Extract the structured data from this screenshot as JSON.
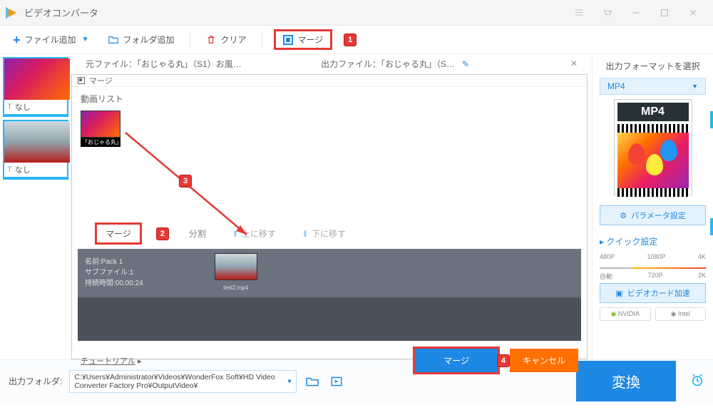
{
  "app": {
    "title": "ビデオコンバータ"
  },
  "toolbar": {
    "add_file": "ファイル追加",
    "add_folder": "フォルダ追加",
    "clear": "クリア",
    "merge": "マージ"
  },
  "badges": {
    "b1": "1",
    "b2": "2",
    "b3": "3",
    "b4": "4"
  },
  "left_thumbs": {
    "items": [
      {
        "label": "なし"
      },
      {
        "label": "なし"
      }
    ]
  },
  "file_header": {
    "source_label": "元ファイル：",
    "source_value": "「おじゃる丸」（S1）お風…",
    "output_label": "出力ファイル：",
    "output_value": "「おじゃる丸」（S…"
  },
  "merge_dialog": {
    "title": "マージ",
    "video_list_label": "動画リスト",
    "thumb_name": "「おじゃる丸」",
    "mid_buttons": {
      "merge": "マージ",
      "split": "分割",
      "move_up": "上に移す",
      "move_down": "下に移す"
    },
    "pack": {
      "name_label": "名前:Pack 1",
      "subfile_label": "サブファイル:1",
      "duration_label": "持続時間:00:00:24",
      "thumb_name": "test2.mp4"
    },
    "tutorial": "チュートリアル",
    "merge_btn": "マージ",
    "cancel_btn": "キャンセル"
  },
  "right_panel": {
    "format_title": "出力フォーマットを選択",
    "format_name": "MP4",
    "format_badge": "MP4",
    "param_btn": "パラメータ設定",
    "quick_title": "クイック設定",
    "quality": {
      "q1": "480P",
      "q2": "1080P",
      "q3": "4K",
      "r1": "自動",
      "r2": "720P",
      "r3": "2K"
    },
    "gpu_btn": "ビデオカード加速",
    "gpu1": "NVIDIA",
    "gpu2": "Intel"
  },
  "bottom": {
    "output_label": "出力フォルダ:",
    "output_path": "C:¥Users¥Administrator¥Videos¥WonderFox Soft¥HD Video Converter Factory Pro¥OutputVideo¥",
    "convert": "変換"
  }
}
